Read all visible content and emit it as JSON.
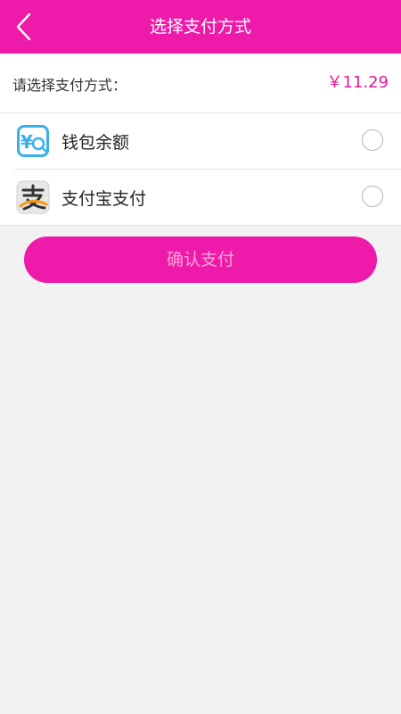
{
  "header": {
    "title": "选择支付方式",
    "back_icon": "chevron-left-icon"
  },
  "order": {
    "label": "请选择支付方式：",
    "amount": "￥11.29"
  },
  "payment_methods": [
    {
      "label": "钱包余额",
      "icon": "wallet-icon",
      "selected": false
    },
    {
      "label": "支付宝支付",
      "icon": "alipay-icon",
      "selected": false
    }
  ],
  "confirm": {
    "label": "确认支付"
  },
  "colors": {
    "accent": "#ee1aa9",
    "amount": "#e5199c",
    "confirm_text": "#f7a6d6",
    "background": "#f2f2f2"
  }
}
